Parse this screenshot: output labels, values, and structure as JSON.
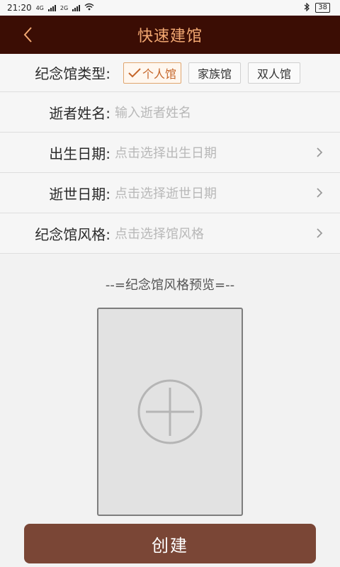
{
  "status_bar": {
    "time": "21:20",
    "net_left": "4G",
    "net_right": "2G",
    "battery": "38"
  },
  "nav": {
    "title": "快速建馆"
  },
  "form": {
    "type": {
      "label": "纪念馆类型:",
      "options": [
        "个人馆",
        "家族馆",
        "双人馆"
      ],
      "selected": "个人馆"
    },
    "name": {
      "label": "逝者姓名:",
      "placeholder": "输入逝者姓名"
    },
    "birth": {
      "label": "出生日期:",
      "placeholder": "点击选择出生日期"
    },
    "death": {
      "label": "逝世日期:",
      "placeholder": "点击选择逝世日期"
    },
    "style": {
      "label": "纪念馆风格:",
      "placeholder": "点击选择馆风格"
    }
  },
  "preview": {
    "title": "--=纪念馆风格预览=--"
  },
  "actions": {
    "create_label": "创建"
  },
  "colors": {
    "nav_bg": "#3b0d04",
    "title": "#f2a872",
    "accent": "#c5662a",
    "button": "#7a4636"
  }
}
